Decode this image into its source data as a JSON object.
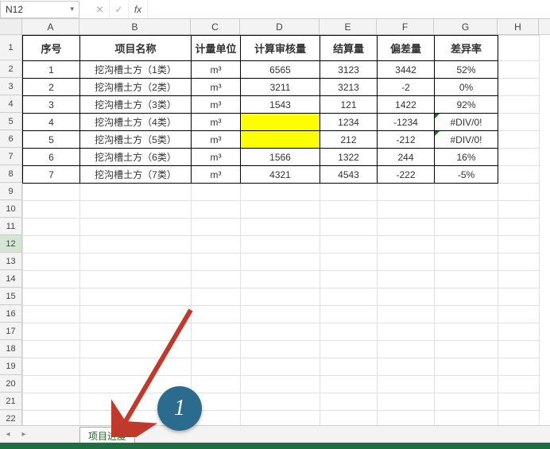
{
  "formula_bar": {
    "cell_ref": "N12",
    "cancel_glyph": "✕",
    "accept_glyph": "✓",
    "fx_label": "fx",
    "value": ""
  },
  "columns": [
    "A",
    "B",
    "C",
    "D",
    "E",
    "F",
    "G",
    "H"
  ],
  "row_count": 22,
  "selected_row": 12,
  "table": {
    "headers": [
      "序号",
      "项目名称",
      "计量单位",
      "计算审核量",
      "结算量",
      "偏差量",
      "差异率"
    ],
    "rows": [
      {
        "seq": "1",
        "name": "挖沟槽土方（1类）",
        "unit": "m³",
        "audit": "6565",
        "settle": "3123",
        "dev": "3442",
        "rate": "52%",
        "hl": false,
        "err": false
      },
      {
        "seq": "2",
        "name": "挖沟槽土方（2类）",
        "unit": "m³",
        "audit": "3211",
        "settle": "3213",
        "dev": "-2",
        "rate": "0%",
        "hl": false,
        "err": false
      },
      {
        "seq": "3",
        "name": "挖沟槽土方（3类）",
        "unit": "m³",
        "audit": "1543",
        "settle": "121",
        "dev": "1422",
        "rate": "92%",
        "hl": false,
        "err": false
      },
      {
        "seq": "4",
        "name": "挖沟槽土方（4类）",
        "unit": "m³",
        "audit": "",
        "settle": "1234",
        "dev": "-1234",
        "rate": "#DIV/0!",
        "hl": true,
        "err": true
      },
      {
        "seq": "5",
        "name": "挖沟槽土方（5类）",
        "unit": "m³",
        "audit": "",
        "settle": "212",
        "dev": "-212",
        "rate": "#DIV/0!",
        "hl": true,
        "err": true
      },
      {
        "seq": "6",
        "name": "挖沟槽土方（6类）",
        "unit": "m³",
        "audit": "1566",
        "settle": "1322",
        "dev": "244",
        "rate": "16%",
        "hl": false,
        "err": false
      },
      {
        "seq": "7",
        "name": "挖沟槽土方（7类）",
        "unit": "m³",
        "audit": "4321",
        "settle": "4543",
        "dev": "-222",
        "rate": "-5%",
        "hl": false,
        "err": false
      }
    ]
  },
  "sheet_tab": {
    "name": "项目进度",
    "nav_prev": "◂",
    "nav_next": "▸"
  },
  "annotation": {
    "number": "1"
  },
  "chart_data": {
    "type": "table",
    "title": "",
    "columns": [
      "序号",
      "项目名称",
      "计量单位",
      "计算审核量",
      "结算量",
      "偏差量",
      "差异率"
    ],
    "rows": [
      [
        1,
        "挖沟槽土方（1类）",
        "m³",
        6565,
        3123,
        3442,
        "52%"
      ],
      [
        2,
        "挖沟槽土方（2类）",
        "m³",
        3211,
        3213,
        -2,
        "0%"
      ],
      [
        3,
        "挖沟槽土方（3类）",
        "m³",
        1543,
        121,
        1422,
        "92%"
      ],
      [
        4,
        "挖沟槽土方（4类）",
        "m³",
        null,
        1234,
        -1234,
        "#DIV/0!"
      ],
      [
        5,
        "挖沟槽土方（5类）",
        "m³",
        null,
        212,
        -212,
        "#DIV/0!"
      ],
      [
        6,
        "挖沟槽土方（6类）",
        "m³",
        1566,
        1322,
        244,
        "16%"
      ],
      [
        7,
        "挖沟槽土方（7类）",
        "m³",
        4321,
        4543,
        -222,
        "-5%"
      ]
    ]
  }
}
